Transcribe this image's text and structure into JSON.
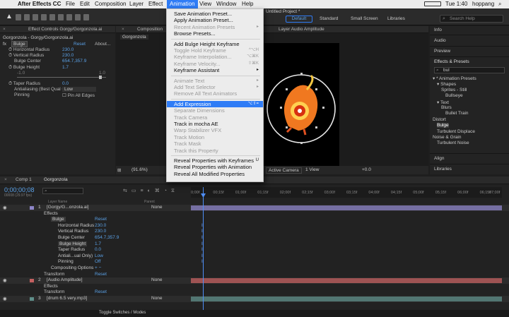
{
  "menubar": {
    "apple_glyph": "",
    "app": "After Effects CC",
    "items": [
      "File",
      "Edit",
      "Composition",
      "Layer",
      "Effect",
      "Animation",
      "View",
      "Window",
      "Help"
    ],
    "clock": "Tue 1:40",
    "user": "hoppang"
  },
  "window": {
    "title": "Untitled Project *"
  },
  "workspace": {
    "tabs": [
      "Default",
      "Standard",
      "Small Screen",
      "Libraries"
    ],
    "search_placeholder": "Search Help"
  },
  "effect_controls": {
    "tab": "Effect Controls Gorgy/Gorgonzola.ai",
    "title": "Gorgonzola - Gorgy/Gorgonzola.ai",
    "effect": "Bulge",
    "reset": "Reset",
    "about": "About...",
    "props": [
      {
        "name": "Horizontal Radius",
        "value": "230.0"
      },
      {
        "name": "Vertical Radius",
        "value": "230.0"
      },
      {
        "name": "Bulge Center",
        "value": "654.7,357.9"
      },
      {
        "name": "Bulge Height",
        "value": "1.7"
      }
    ],
    "range_min": "-1.0",
    "range_max": "1.0",
    "taper": {
      "name": "Taper Radius",
      "value": "0.0"
    },
    "antialias": {
      "name": "Antialiasing (Best Qual O",
      "value": "Low"
    },
    "pinning": {
      "name": "Pinning",
      "value": "Pin All Edges"
    }
  },
  "composition": {
    "tab": "Composition",
    "sub": "Gorgonzola",
    "layer_tab": "Layer Audio Amplitude",
    "zoom": "(91.6%)",
    "camera": "Active Camera",
    "view": "1 View",
    "exposure": "+0.0"
  },
  "right_panels": {
    "items": [
      "Info",
      "Audio",
      "Preview",
      "Effects & Presets"
    ],
    "search_value": "bul",
    "tree": [
      {
        "label": "* Animation Presets",
        "level": 0
      },
      {
        "label": "Shapes",
        "level": 1
      },
      {
        "label": "Sprites - Still",
        "level": 2
      },
      {
        "label": "Bullseye",
        "level": 3
      },
      {
        "label": "Text",
        "level": 1
      },
      {
        "label": "Blurs",
        "level": 2
      },
      {
        "label": "Bullet Train",
        "level": 3
      },
      {
        "label": "Distort",
        "level": 0
      },
      {
        "label": "Bulge",
        "level": 1
      },
      {
        "label": "Turbulent Displace",
        "level": 1
      },
      {
        "label": "Noise & Grain",
        "level": 0
      },
      {
        "label": "Turbulent Noise",
        "level": 1
      }
    ],
    "bottom": [
      "Align",
      "Libraries"
    ]
  },
  "animation_menu": {
    "items": [
      {
        "label": "Save Animation Preset...",
        "state": "enabled"
      },
      {
        "label": "Apply Animation Preset...",
        "state": "enabled"
      },
      {
        "label": "Recent Animation Presets",
        "state": "disabled",
        "arrow": "▸"
      },
      {
        "label": "Browse Presets...",
        "state": "enabled"
      },
      {
        "sep": true
      },
      {
        "label": "Add Bulge Height Keyframe",
        "state": "enabled"
      },
      {
        "label": "Toggle Hold Keyframe",
        "state": "disabled",
        "shortcut": "^⌥H"
      },
      {
        "label": "Keyframe Interpolation...",
        "state": "disabled",
        "shortcut": "⌥⌘K"
      },
      {
        "label": "Keyframe Velocity...",
        "state": "disabled",
        "shortcut": "⇧⌘K"
      },
      {
        "label": "Keyframe Assistant",
        "state": "enabled",
        "arrow": "▸"
      },
      {
        "sep": true
      },
      {
        "label": "Animate Text",
        "state": "disabled",
        "arrow": "▸"
      },
      {
        "label": "Add Text Selector",
        "state": "disabled",
        "arrow": "▸"
      },
      {
        "label": "Remove All Text Animators",
        "state": "disabled"
      },
      {
        "sep": true
      },
      {
        "label": "Add Expression",
        "state": "selected",
        "shortcut": "⌥⇧="
      },
      {
        "label": "Separate Dimensions",
        "state": "disabled"
      },
      {
        "label": "Track Camera",
        "state": "disabled"
      },
      {
        "label": "Track in mocha AE",
        "state": "enabled"
      },
      {
        "label": "Warp Stabilizer VFX",
        "state": "disabled"
      },
      {
        "label": "Track Motion",
        "state": "disabled"
      },
      {
        "label": "Track Mask",
        "state": "disabled"
      },
      {
        "label": "Track this Property",
        "state": "disabled"
      },
      {
        "sep": true
      },
      {
        "label": "Reveal Properties with Keyframes",
        "state": "enabled",
        "shortcut": "U"
      },
      {
        "label": "Reveal Properties with Animation",
        "state": "enabled"
      },
      {
        "label": "Reveal All Modified Properties",
        "state": "enabled"
      }
    ]
  },
  "timeline": {
    "tabs": [
      "Comp 1",
      "Gorgonzola"
    ],
    "timecode": "0;00;00;08",
    "frame_info": "00008 (29.97 fps)",
    "search_placeholder": "",
    "col_layer": "Layer Name",
    "col_parent": "Parent",
    "ruler": [
      "0;00f",
      "00;15f",
      "01;00f",
      "01;15f",
      "02;00f",
      "02;15f",
      "03;00f",
      "03;15f",
      "04;00f",
      "04;15f",
      "05;00f",
      "05;15f",
      "06;00f",
      "06;15f",
      "07;00f"
    ],
    "rows": [
      {
        "indent": 0,
        "num": "1",
        "name": "[Gorgy/G...onzola.ai]",
        "parent": "None"
      },
      {
        "indent": 1,
        "name": "Effects"
      },
      {
        "indent": 2,
        "name": "Bulge",
        "value": "Reset"
      },
      {
        "indent": 3,
        "name": "Horizontal Radius",
        "value": "230.0"
      },
      {
        "indent": 3,
        "name": "Vertical Radius",
        "value": "230.0"
      },
      {
        "indent": 3,
        "name": "Bulge Center",
        "value": "654.7,357.9"
      },
      {
        "indent": 3,
        "name": "Bulge Height",
        "value": "1.7"
      },
      {
        "indent": 3,
        "name": "Taper Radius",
        "value": "0.0"
      },
      {
        "indent": 3,
        "name": "Antiali...ual Only)",
        "value": "Low"
      },
      {
        "indent": 3,
        "name": "Pinning",
        "value": "Off"
      },
      {
        "indent": 2,
        "name": "Compositing Options",
        "value": "+ −"
      },
      {
        "indent": 1,
        "name": "Transform",
        "value": "Reset"
      },
      {
        "indent": 0,
        "num": "2",
        "name": "[Audio Amplitude]",
        "parent": "None"
      },
      {
        "indent": 1,
        "name": "Effects"
      },
      {
        "indent": 1,
        "name": "Transform",
        "value": "Reset"
      },
      {
        "indent": 0,
        "num": "3",
        "name": "[drum 6.5 very.mp3]",
        "parent": "None"
      }
    ],
    "footer": "Toggle Switches / Modes"
  },
  "colors": {
    "accent": "#2f7cf6",
    "link": "#5aa0e6",
    "layer1": "#8e86c9",
    "layer2": "#c46060",
    "layer3": "#5f8f8a"
  }
}
